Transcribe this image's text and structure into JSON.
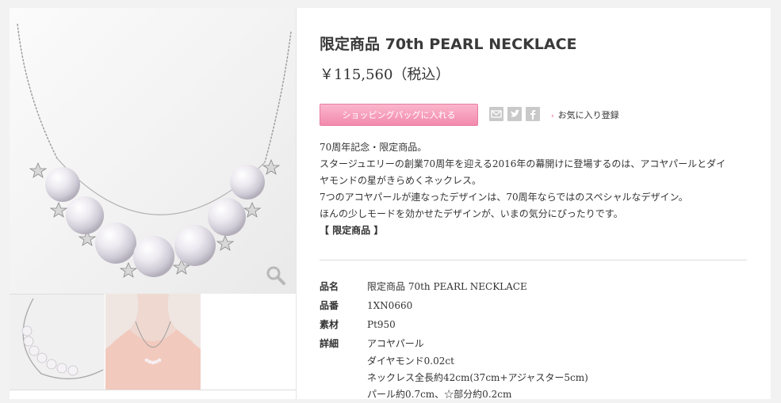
{
  "product": {
    "title": "限定商品 70th PEARL NECKLACE",
    "price": "￥115,560（税込）"
  },
  "actions": {
    "cart_label": "ショッピングバッグに入れる",
    "favorite_label": "お気に入り登録",
    "favorite_arrow": "›"
  },
  "share": {
    "icons": [
      "mail-icon",
      "twitter-icon",
      "facebook-icon"
    ]
  },
  "description": {
    "lines": [
      "70周年記念・限定商品。",
      "スタージュエリーの創業70周年を迎える2016年の幕開けに登場するのは、アコヤパールとダイ",
      "ヤモンドの星がきらめくネックレス。",
      "7つのアコヤパールが連なったデザインは、70周年ならではのスペシャルなデザイン。",
      "ほんの少しモードを効かせたデザインが、いまの気分にぴったりです。"
    ],
    "tag": "【 限定商品 】"
  },
  "specs": {
    "name_label": "品名",
    "name_value": "限定商品 70th PEARL NECKLACE",
    "number_label": "品番",
    "number_value": "1XN0660",
    "material_label": "素材",
    "material_value": "Pt950",
    "details_label": "詳細",
    "details_lines": [
      "アコヤパール",
      "ダイヤモンド0.02ct",
      "ネックレス全長約42cm(37cm+アジャスター5cm)",
      "パール約0.7cm、☆部分約0.2cm"
    ]
  },
  "colors": {
    "accent_pink": "#f28aae",
    "background": "#f2f2f2"
  }
}
